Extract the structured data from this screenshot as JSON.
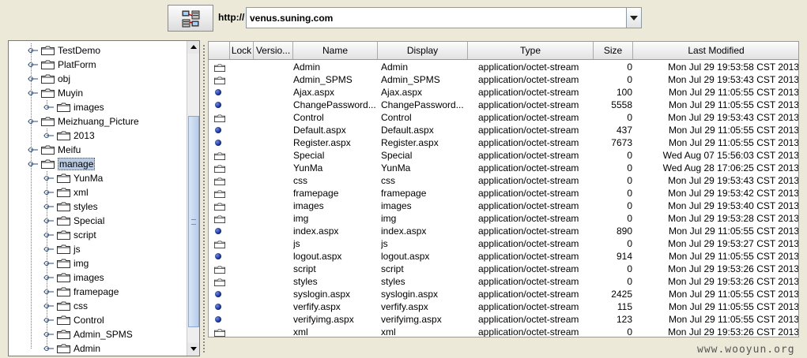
{
  "toolbar": {
    "protocol": "http://",
    "url": "venus.suning.com"
  },
  "tree": {
    "items": [
      {
        "label": "TestDemo",
        "level": 1
      },
      {
        "label": "PlatForm",
        "level": 1
      },
      {
        "label": "obj",
        "level": 1
      },
      {
        "label": "Muyin",
        "level": 1,
        "expanded": true
      },
      {
        "label": "images",
        "level": 2
      },
      {
        "label": "Meizhuang_Picture",
        "level": 1,
        "expanded": true
      },
      {
        "label": "2013",
        "level": 2
      },
      {
        "label": "Meifu",
        "level": 1
      },
      {
        "label": "manage",
        "level": 1,
        "expanded": true,
        "selected": true
      },
      {
        "label": "YunMa",
        "level": 2
      },
      {
        "label": "xml",
        "level": 2
      },
      {
        "label": "styles",
        "level": 2
      },
      {
        "label": "Special",
        "level": 2
      },
      {
        "label": "script",
        "level": 2
      },
      {
        "label": "js",
        "level": 2
      },
      {
        "label": "img",
        "level": 2
      },
      {
        "label": "images",
        "level": 2
      },
      {
        "label": "framepage",
        "level": 2
      },
      {
        "label": "css",
        "level": 2
      },
      {
        "label": "Control",
        "level": 2
      },
      {
        "label": "Admin_SPMS",
        "level": 2
      },
      {
        "label": "Admin",
        "level": 2
      }
    ]
  },
  "table": {
    "columns": [
      "Lock",
      "Versio...",
      "Name",
      "Display",
      "Type",
      "Size",
      "Last Modified"
    ],
    "rows": [
      {
        "kind": "folder",
        "name": "Admin",
        "display": "Admin",
        "type": "application/octet-stream",
        "size": "0",
        "modified": "Mon Jul 29 19:53:58 CST 2013"
      },
      {
        "kind": "folder",
        "name": "Admin_SPMS",
        "display": "Admin_SPMS",
        "type": "application/octet-stream",
        "size": "0",
        "modified": "Mon Jul 29 19:53:43 CST 2013"
      },
      {
        "kind": "file",
        "name": "Ajax.aspx",
        "display": "Ajax.aspx",
        "type": "application/octet-stream",
        "size": "100",
        "modified": "Mon Jul 29 11:05:55 CST 2013"
      },
      {
        "kind": "file",
        "name": "ChangePassword...",
        "display": "ChangePassword...",
        "type": "application/octet-stream",
        "size": "5558",
        "modified": "Mon Jul 29 11:05:55 CST 2013"
      },
      {
        "kind": "folder",
        "name": "Control",
        "display": "Control",
        "type": "application/octet-stream",
        "size": "0",
        "modified": "Mon Jul 29 19:53:43 CST 2013"
      },
      {
        "kind": "file",
        "name": "Default.aspx",
        "display": "Default.aspx",
        "type": "application/octet-stream",
        "size": "437",
        "modified": "Mon Jul 29 11:05:55 CST 2013"
      },
      {
        "kind": "file",
        "name": "Register.aspx",
        "display": "Register.aspx",
        "type": "application/octet-stream",
        "size": "7673",
        "modified": "Mon Jul 29 11:05:55 CST 2013"
      },
      {
        "kind": "folder",
        "name": "Special",
        "display": "Special",
        "type": "application/octet-stream",
        "size": "0",
        "modified": "Wed Aug 07 15:56:03 CST 2013"
      },
      {
        "kind": "folder",
        "name": "YunMa",
        "display": "YunMa",
        "type": "application/octet-stream",
        "size": "0",
        "modified": "Wed Aug 28 17:06:25 CST 2013"
      },
      {
        "kind": "folder",
        "name": "css",
        "display": "css",
        "type": "application/octet-stream",
        "size": "0",
        "modified": "Mon Jul 29 19:53:43 CST 2013"
      },
      {
        "kind": "folder",
        "name": "framepage",
        "display": "framepage",
        "type": "application/octet-stream",
        "size": "0",
        "modified": "Mon Jul 29 19:53:42 CST 2013"
      },
      {
        "kind": "folder",
        "name": "images",
        "display": "images",
        "type": "application/octet-stream",
        "size": "0",
        "modified": "Mon Jul 29 19:53:40 CST 2013"
      },
      {
        "kind": "folder",
        "name": "img",
        "display": "img",
        "type": "application/octet-stream",
        "size": "0",
        "modified": "Mon Jul 29 19:53:28 CST 2013"
      },
      {
        "kind": "file",
        "name": "index.aspx",
        "display": "index.aspx",
        "type": "application/octet-stream",
        "size": "890",
        "modified": "Mon Jul 29 11:05:55 CST 2013"
      },
      {
        "kind": "folder",
        "name": "js",
        "display": "js",
        "type": "application/octet-stream",
        "size": "0",
        "modified": "Mon Jul 29 19:53:27 CST 2013"
      },
      {
        "kind": "file",
        "name": "logout.aspx",
        "display": "logout.aspx",
        "type": "application/octet-stream",
        "size": "914",
        "modified": "Mon Jul 29 11:05:55 CST 2013"
      },
      {
        "kind": "folder",
        "name": "script",
        "display": "script",
        "type": "application/octet-stream",
        "size": "0",
        "modified": "Mon Jul 29 19:53:26 CST 2013"
      },
      {
        "kind": "folder",
        "name": "styles",
        "display": "styles",
        "type": "application/octet-stream",
        "size": "0",
        "modified": "Mon Jul 29 19:53:26 CST 2013"
      },
      {
        "kind": "file",
        "name": "syslogin.aspx",
        "display": "syslogin.aspx",
        "type": "application/octet-stream",
        "size": "2425",
        "modified": "Mon Jul 29 11:05:55 CST 2013"
      },
      {
        "kind": "file",
        "name": "verfify.aspx",
        "display": "verfify.aspx",
        "type": "application/octet-stream",
        "size": "115",
        "modified": "Mon Jul 29 11:05:55 CST 2013"
      },
      {
        "kind": "file",
        "name": "verifyimg.aspx",
        "display": "verifyimg.aspx",
        "type": "application/octet-stream",
        "size": "123",
        "modified": "Mon Jul 29 11:05:55 CST 2013"
      },
      {
        "kind": "folder",
        "name": "xml",
        "display": "xml",
        "type": "application/octet-stream",
        "size": "0",
        "modified": "Mon Jul 29 19:53:26 CST 2013"
      }
    ]
  },
  "watermark": "www.wooyun.org"
}
